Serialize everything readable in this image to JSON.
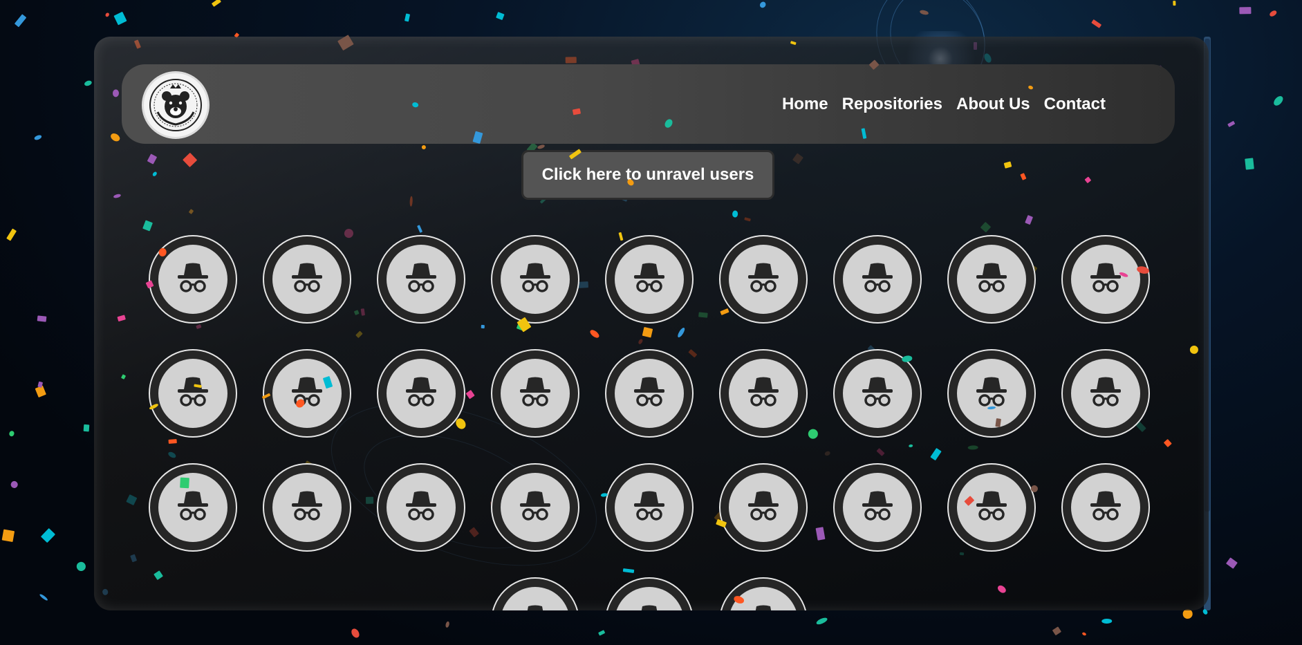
{
  "nav": {
    "logo_alt": "bear logo",
    "links": [
      "Home",
      "Repositories",
      "About Us",
      "Contact"
    ]
  },
  "main": {
    "unravel_button_label": "Click here to unravel users"
  },
  "users": {
    "avatar_icon": "incognito-icon",
    "count": 30
  },
  "colors": {
    "panel": "#1a1a1a",
    "navbar": "#4a4a4a",
    "button": "#545454",
    "avatar_ring": "#262626",
    "avatar_face": "#d2d2d2"
  }
}
